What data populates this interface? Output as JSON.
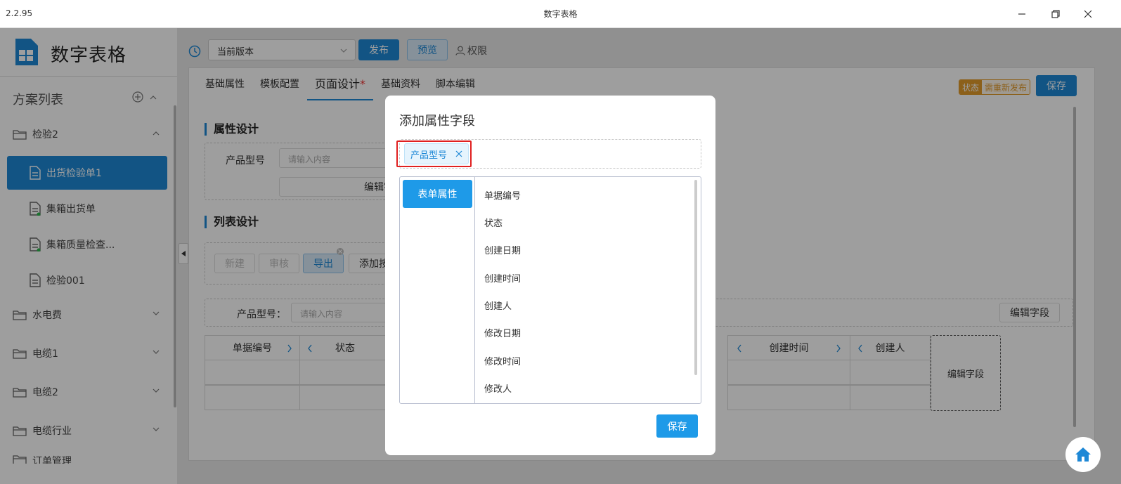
{
  "window": {
    "version": "2.2.95",
    "title": "数字表格"
  },
  "app": {
    "title": "数字表格"
  },
  "sidebar": {
    "list_header": "方案列表",
    "groups": [
      {
        "label": "检验2",
        "expanded": true
      },
      {
        "label": "水电费"
      },
      {
        "label": "电缆1"
      },
      {
        "label": "电缆2"
      },
      {
        "label": "电缆行业"
      },
      {
        "label": "订单管理"
      }
    ],
    "files": [
      {
        "label": "出货检验单1",
        "active": true
      },
      {
        "label": "集箱出货单"
      },
      {
        "label": "集箱质量检查..."
      },
      {
        "label": "检验001"
      }
    ]
  },
  "toolbar": {
    "version_select": "当前版本",
    "publish_label": "发布",
    "preview_label": "预览",
    "permission_label": "权限"
  },
  "tabs": [
    {
      "label": "基础属性"
    },
    {
      "label": "模板配置"
    },
    {
      "label": "页面设计",
      "active": true,
      "required_mark": "*"
    },
    {
      "label": "基础资料"
    },
    {
      "label": "脚本编辑"
    }
  ],
  "status": {
    "key": "状态",
    "value": "需重新发布"
  },
  "save_label": "保存",
  "attr_section": {
    "title": "属性设计",
    "field_label": "产品型号",
    "field_placeholder": "请输入内容",
    "edit_label": "编辑字"
  },
  "list_section": {
    "title": "列表设计",
    "buttons": [
      "新建",
      "审核",
      "导出",
      "添加按"
    ],
    "filter_label": "产品型号：",
    "filter_placeholder": "请输入内容",
    "edit_fields_label": "编辑字段",
    "columns": [
      "单据编号",
      "状态",
      "创建时间",
      "创建人"
    ],
    "edit_field_cell": "编辑字段"
  },
  "modal": {
    "title": "添加属性字段",
    "selected_chip": "产品型号",
    "category": "表单属性",
    "fields": [
      "单据编号",
      "状态",
      "创建日期",
      "创建时间",
      "创建人",
      "修改日期",
      "修改时间",
      "修改人"
    ],
    "save_label": "保存"
  },
  "colors": {
    "primary": "#1e88d6",
    "accent": "#1e9ae8",
    "warning": "#e39b2b",
    "highlight": "#e02020"
  }
}
